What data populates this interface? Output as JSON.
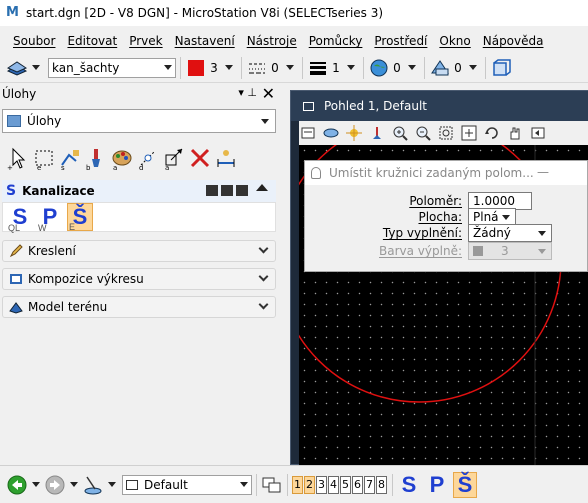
{
  "window": {
    "title": "start.dgn [2D - V8 DGN] - MicroStation V8i (SELECTseries 3)"
  },
  "menu": [
    "Soubor",
    "Editovat",
    "Prvek",
    "Nastavení",
    "Nástroje",
    "Pomůcky",
    "Prostředí",
    "Okno",
    "Nápověda"
  ],
  "attributes": {
    "level": "kan_šachty",
    "color_index": "3",
    "linestyle_index": "0",
    "weight_index": "1",
    "transparency": "0",
    "priority": "0",
    "colors": {
      "active_color": "#e01010"
    }
  },
  "tasks_panel": {
    "title": "Úlohy",
    "selector": "Úlohy",
    "active_group": {
      "label": "Kanalizace",
      "icon_letter": "S",
      "buttons": [
        {
          "glyph": "S",
          "sub": "QL"
        },
        {
          "glyph": "P",
          "sub": "W"
        },
        {
          "glyph": "Š",
          "sub": "E"
        }
      ]
    },
    "groups": [
      "Kreslení",
      "Kompozice výkresu",
      "Model terénu"
    ]
  },
  "view": {
    "title": "Pohled 1, Default"
  },
  "dialog": {
    "title": "Umístit kružnici zadaným polom...",
    "minimize": "—",
    "fields": [
      {
        "label": "Poloměr:",
        "value": "1.0000"
      },
      {
        "label": "Plocha:",
        "value": "Plná"
      },
      {
        "label": "Typ vyplnění:",
        "value": "Žádný"
      },
      {
        "label": "Barva výplně:",
        "value": "3"
      }
    ]
  },
  "bottom": {
    "view_group": "Default",
    "view_numbers": [
      "1",
      "2",
      "3",
      "4",
      "5",
      "6",
      "7",
      "8"
    ],
    "tools": [
      "S",
      "P",
      "Š"
    ]
  }
}
